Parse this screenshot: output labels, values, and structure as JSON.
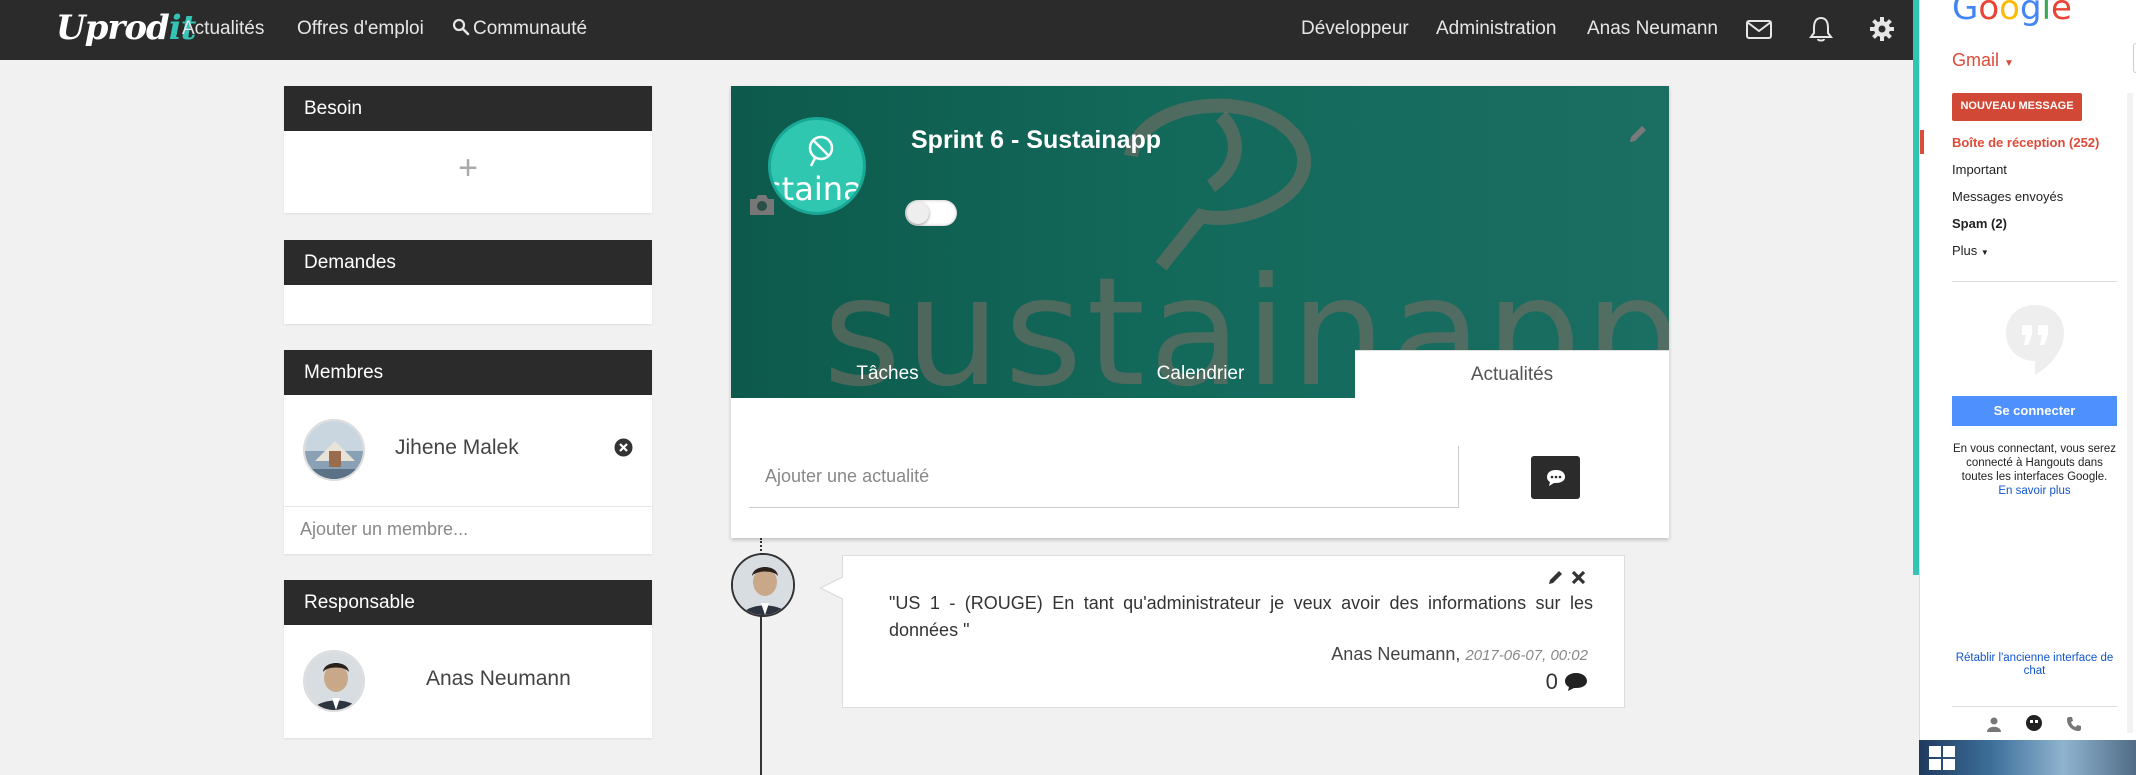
{
  "navbar": {
    "logo_main": "Uprod",
    "logo_accent": "it",
    "links": [
      "Actualités",
      "Offres d'emploi",
      "Communauté"
    ],
    "right_links": [
      "Développeur",
      "Administration",
      "Anas Neumann"
    ]
  },
  "sidebar": {
    "besoin": {
      "title": "Besoin",
      "add_symbol": "+"
    },
    "demandes": {
      "title": "Demandes"
    },
    "membres": {
      "title": "Membres",
      "member_name": "Jihene Malek",
      "add_placeholder": "Ajouter un membre..."
    },
    "responsable": {
      "title": "Responsable",
      "name": "Anas Neumann"
    }
  },
  "project": {
    "title": "Sprint 6 - Sustainapp",
    "watermark": "sustainapp",
    "logo_text": "stainap",
    "tabs": [
      "Tâches",
      "Calendrier",
      "Actualités"
    ],
    "active_tab": "Actualités",
    "news_placeholder": "Ajouter une actualité"
  },
  "post": {
    "text": "\"US 1 - (ROUGE) En tant qu'administrateur je veux avoir des informations sur les données \"",
    "author": "Anas Neumann,",
    "date": "2017-06-07, 00:02",
    "comment_count": "0"
  },
  "gmail": {
    "logo_letters": [
      "G",
      "o",
      "o",
      "g",
      "l",
      "e"
    ],
    "logo_colors": [
      "#4285f4",
      "#ea4335",
      "#fbbc05",
      "#4285f4",
      "#34a853",
      "#ea4335"
    ],
    "gmail_label": "Gmail",
    "compose": "NOUVEAU MESSAGE",
    "inbox": "Boîte de réception (252)",
    "important": "Important",
    "sent": "Messages envoyés",
    "spam": "Spam (2)",
    "more": "Plus",
    "connect": "Se connecter",
    "desc": "En vous connectant, vous serez connecté à Hangouts dans toutes les interfaces Google.",
    "learn_more": "En savoir plus",
    "restore": "Rétablir l'ancienne interface de chat"
  },
  "colors": {
    "navbar": "#2b2b2b",
    "accent": "#33c4b6",
    "banner": "#136a5b",
    "gmail_red": "#d14836",
    "google_blue": "#4d90fe"
  },
  "icons": [
    "search-icon",
    "envelope-icon",
    "bell-icon",
    "gear-icon",
    "pencil-icon",
    "camera-icon",
    "close-circle-icon",
    "comment-icon",
    "close-icon",
    "hangouts-icon",
    "person-icon",
    "phone-icon"
  ]
}
